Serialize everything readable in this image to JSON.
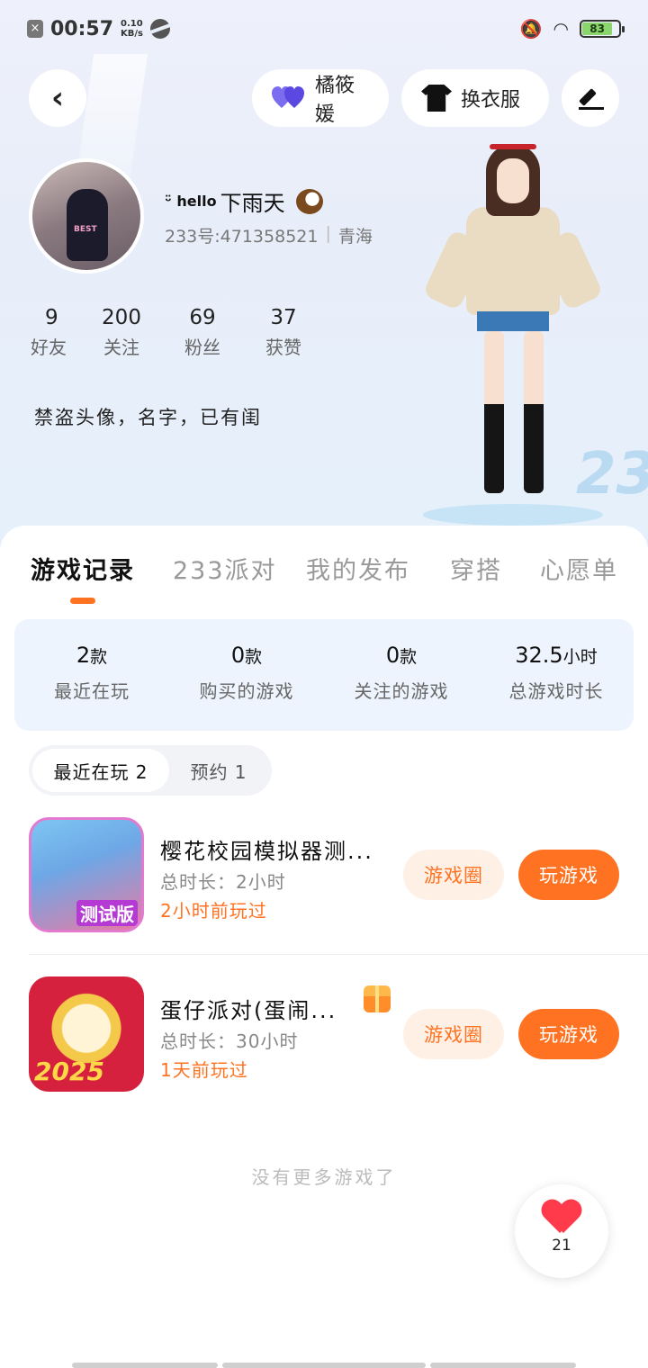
{
  "status_bar": {
    "time": "00:57",
    "speed_value": "0.10",
    "speed_unit": "KB/s",
    "battery": "83"
  },
  "header": {
    "couple_label": "橘筱媛",
    "outfit_label": "换衣服"
  },
  "profile": {
    "name_prefix": "ᵕ̈ hello",
    "name": "下雨天",
    "id_text": "233号:471358521",
    "location": "青海",
    "bio": "禁盗头像，名字，已有闺"
  },
  "stats": [
    {
      "value": "9",
      "label": "好友"
    },
    {
      "value": "200",
      "label": "关注"
    },
    {
      "value": "69",
      "label": "粉丝"
    },
    {
      "value": "37",
      "label": "获赞"
    }
  ],
  "tabs": [
    "游戏记录",
    "233派对",
    "我的发布",
    "穿搭",
    "心愿单"
  ],
  "summary": [
    {
      "value": "2",
      "unit": "款",
      "label": "最近在玩"
    },
    {
      "value": "0",
      "unit": "款",
      "label": "购买的游戏"
    },
    {
      "value": "0",
      "unit": "款",
      "label": "关注的游戏"
    },
    {
      "value": "32.5",
      "unit": "小时",
      "label": "总游戏时长"
    }
  ],
  "segments": {
    "recent": "最近在玩 2",
    "reserve": "预约 1"
  },
  "games": [
    {
      "title": "樱花校园模拟器测...",
      "duration": "总时长：2小时",
      "last_played": "2小时前玩过",
      "circle_label": "游戏圈",
      "play_label": "玩游戏"
    },
    {
      "title": "蛋仔派对(蛋闹...",
      "duration": "总时长：30小时",
      "last_played": "1天前玩过",
      "circle_label": "游戏圈",
      "play_label": "玩游戏"
    }
  ],
  "footer_text": "没有更多游戏了",
  "like_count": "21",
  "colors": {
    "accent": "#ff7222",
    "summary_bg": "#eef4fd",
    "heart": "#ff3a4a"
  }
}
